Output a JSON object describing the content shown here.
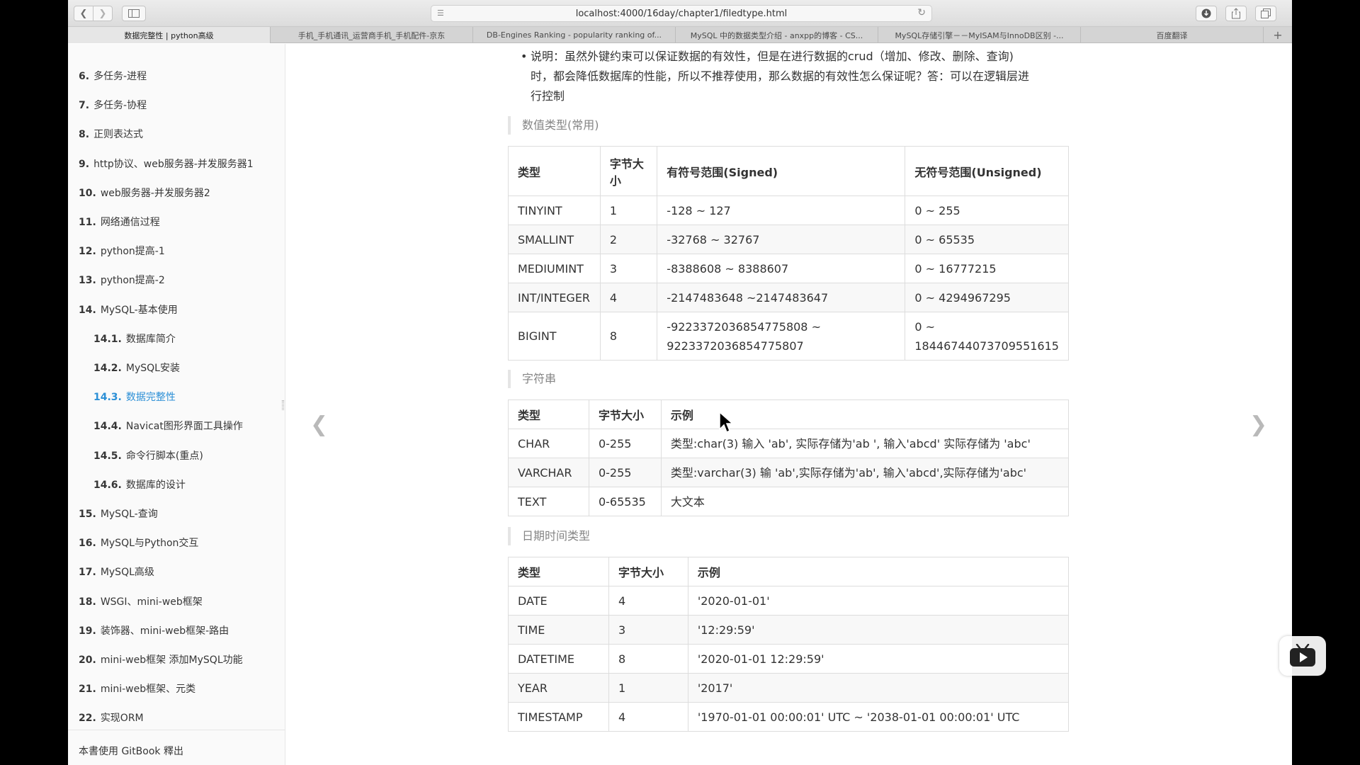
{
  "browser": {
    "url": "localhost:4000/16day/chapter1/filedtype.html",
    "tabs": [
      "数据完整性 | python高级",
      "手机_手机通讯_运营商手机_手机配件-京东",
      "DB-Engines Ranking - popularity ranking of...",
      "MySQL 中的数据类型介绍 - anxpp的博客 - CS...",
      "MySQL存储引擎－－MyISAM与InnoDB区别 -...",
      "百度翻译"
    ],
    "new_tab": "+"
  },
  "sidebar": {
    "items": [
      {
        "num": "6.",
        "label": "多任务-进程",
        "sub": false,
        "active": false
      },
      {
        "num": "7.",
        "label": "多任务-协程",
        "sub": false,
        "active": false
      },
      {
        "num": "8.",
        "label": "正则表达式",
        "sub": false,
        "active": false
      },
      {
        "num": "9.",
        "label": "http协议、web服务器-并发服务器1",
        "sub": false,
        "active": false
      },
      {
        "num": "10.",
        "label": "web服务器-并发服务器2",
        "sub": false,
        "active": false
      },
      {
        "num": "11.",
        "label": "网络通信过程",
        "sub": false,
        "active": false
      },
      {
        "num": "12.",
        "label": "python提高-1",
        "sub": false,
        "active": false
      },
      {
        "num": "13.",
        "label": "python提高-2",
        "sub": false,
        "active": false
      },
      {
        "num": "14.",
        "label": "MySQL-基本使用",
        "sub": false,
        "active": false
      },
      {
        "num": "14.1.",
        "label": "数据库简介",
        "sub": true,
        "active": false
      },
      {
        "num": "14.2.",
        "label": "MySQL安装",
        "sub": true,
        "active": false
      },
      {
        "num": "14.3.",
        "label": "数据完整性",
        "sub": true,
        "active": true
      },
      {
        "num": "14.4.",
        "label": "Navicat图形界面工具操作",
        "sub": true,
        "active": false
      },
      {
        "num": "14.5.",
        "label": "命令行脚本(重点)",
        "sub": true,
        "active": false
      },
      {
        "num": "14.6.",
        "label": "数据库的设计",
        "sub": true,
        "active": false
      },
      {
        "num": "15.",
        "label": "MySQL-查询",
        "sub": false,
        "active": false
      },
      {
        "num": "16.",
        "label": "MySQL与Python交互",
        "sub": false,
        "active": false
      },
      {
        "num": "17.",
        "label": "MySQL高级",
        "sub": false,
        "active": false
      },
      {
        "num": "18.",
        "label": "WSGI、mini-web框架",
        "sub": false,
        "active": false
      },
      {
        "num": "19.",
        "label": "装饰器、mini-web框架-路由",
        "sub": false,
        "active": false
      },
      {
        "num": "20.",
        "label": "mini-web框架 添加MySQL功能",
        "sub": false,
        "active": false
      },
      {
        "num": "21.",
        "label": "mini-web框架、元类",
        "sub": false,
        "active": false
      },
      {
        "num": "22.",
        "label": "实现ORM",
        "sub": false,
        "active": false
      }
    ],
    "footer": "本書使用 GitBook 釋出"
  },
  "content": {
    "note_line1": "说明：虽然外键约束可以保证数据的有效性，但是在进行数据的crud（增加、修改、删除、查询)",
    "note_line2": "时，都会降低数据库的性能，所以不推荐使用，那么数据的有效性怎么保证呢？答：可以在逻辑层进",
    "note_line3": "行控制",
    "numeric": {
      "title": "数值类型(常用)",
      "headers": [
        "类型",
        "字节大小",
        "有符号范围(Signed)",
        "无符号范围(Unsigned)"
      ],
      "rows": [
        [
          "TINYINT",
          "1",
          "-128 ~ 127",
          "0 ~ 255"
        ],
        [
          "SMALLINT",
          "2",
          "-32768 ~ 32767",
          "0 ~ 65535"
        ],
        [
          "MEDIUMINT",
          "3",
          "-8388608 ~ 8388607",
          "0 ~ 16777215"
        ],
        [
          "INT/INTEGER",
          "4",
          "-2147483648 ~2147483647",
          "0 ~ 4294967295"
        ],
        [
          "BIGINT",
          "8",
          "-9223372036854775808 ~ 9223372036854775807",
          "0 ~ 18446744073709551615"
        ]
      ]
    },
    "string": {
      "title": "字符串",
      "headers": [
        "类型",
        "字节大小",
        "示例"
      ],
      "rows": [
        [
          "CHAR",
          "0-255",
          "类型:char(3) 输入 'ab', 实际存储为'ab ', 输入'abcd' 实际存储为 'abc'"
        ],
        [
          "VARCHAR",
          "0-255",
          "类型:varchar(3) 输 'ab',实际存储为'ab', 输入'abcd',实际存储为'abc'"
        ],
        [
          "TEXT",
          "0-65535",
          "大文本"
        ]
      ]
    },
    "datetime": {
      "title": "日期时间类型",
      "headers": [
        "类型",
        "字节大小",
        "示例"
      ],
      "rows": [
        [
          "DATE",
          "4",
          "'2020-01-01'"
        ],
        [
          "TIME",
          "3",
          "'12:29:59'"
        ],
        [
          "DATETIME",
          "8",
          "'2020-01-01 12:29:59'"
        ],
        [
          "YEAR",
          "1",
          "'2017'"
        ],
        [
          "TIMESTAMP",
          "4",
          "'1970-01-01 00:00:01' UTC ~ '2038-01-01 00:00:01' UTC"
        ]
      ]
    }
  }
}
